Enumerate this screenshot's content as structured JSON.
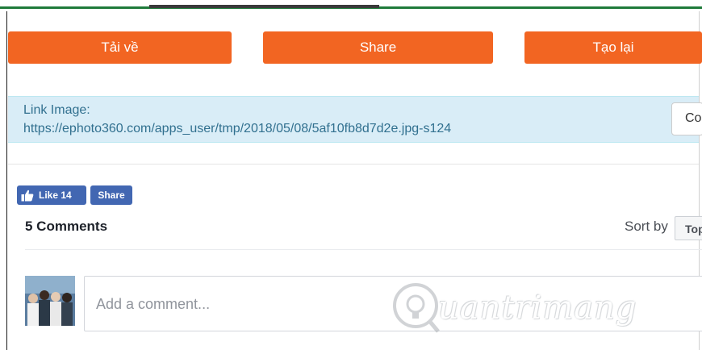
{
  "actions": {
    "download_label": "Tải về",
    "share_label": "Share",
    "recreate_label": "Tạo lại"
  },
  "link_box": {
    "label": "Link Image:",
    "url": "https://ephoto360.com/apps_user/tmp/2018/05/08/5af10fb8d7d2e.jpg-s124",
    "copy_label": "Copy"
  },
  "facebook": {
    "like_label": "Like 14",
    "share_label": "Share"
  },
  "comments": {
    "count_label": "5 Comments",
    "sort_label": "Sort by",
    "sort_value": "Top",
    "input_placeholder": "Add a comment..."
  },
  "watermark": {
    "text": "uantrimang"
  },
  "colors": {
    "orange": "#f26522",
    "facebook_blue": "#4267b2",
    "info_bg": "#d9edf7",
    "info_text": "#31708f"
  }
}
